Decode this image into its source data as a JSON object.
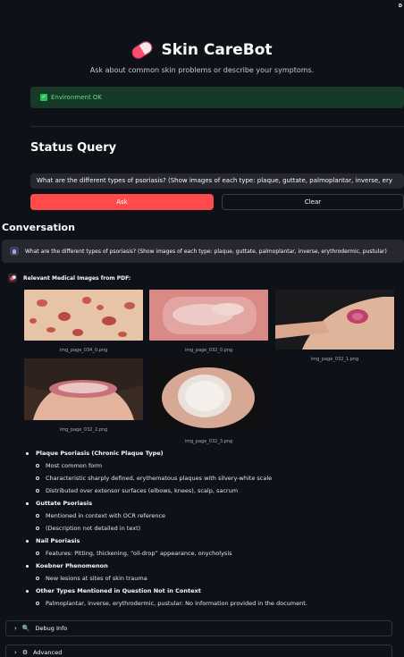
{
  "header": {
    "deploy_label": "D"
  },
  "app": {
    "title": "Skin CareBot",
    "subtitle": "Ask about common skin problems or describe your symptoms."
  },
  "environment": {
    "status": "Environment OK"
  },
  "status_query": {
    "heading": "Status Query",
    "input_value": "What are the different types of psoriasis? (Show images of each type: plaque, guttate, palmoplantar, inverse, ery",
    "ask_label": "Ask",
    "clear_label": "Clear"
  },
  "conversation": {
    "heading": "Conversation",
    "user_message": "What are the different types of psoriasis? (Show images of each type: plaque, guttate, palmoplantar, inverse, erythrodermic, pustular)",
    "bot_heading": "Relevant Medical Images from PDF:",
    "images": [
      {
        "caption": "img_page_034_0.png"
      },
      {
        "caption": "img_page_032_0.png"
      },
      {
        "caption": "img_page_032_1.png"
      },
      {
        "caption": "img_page_032_2.png"
      },
      {
        "caption": "img_page_032_3.png"
      }
    ],
    "answer": [
      {
        "title": "Plaque Psoriasis (Chronic Plaque Type)",
        "items": [
          "Most common form",
          "Characteristic sharply defined, erythematous plaques with silvery-white scale",
          "Distributed over extensor surfaces (elbows, knees), scalp, sacrum"
        ]
      },
      {
        "title": "Guttate Psoriasis",
        "items": [
          "Mentioned in context with OCR reference",
          "(Description not detailed in text)"
        ]
      },
      {
        "title": "Nail Psoriasis",
        "items": [
          "Features: Pitting, thickening, “oil-drop” appearance, onycholysis"
        ]
      },
      {
        "title": "Koebner Phenomenon",
        "items": [
          "New lesions at sites of skin trauma"
        ]
      },
      {
        "title": "Other Types Mentioned in Question Not in Context",
        "items": [
          "Palmoplantar, inverse, erythrodermic, pustular: No information provided in the document."
        ]
      }
    ]
  },
  "expanders": [
    {
      "label": "Debug Info",
      "icon": "magnifier-icon"
    },
    {
      "label": "Advanced",
      "icon": "gear-icon"
    }
  ],
  "colors": {
    "primary": "#ff4b4b",
    "background": "#0e1117",
    "success_text": "#5ce08d"
  }
}
